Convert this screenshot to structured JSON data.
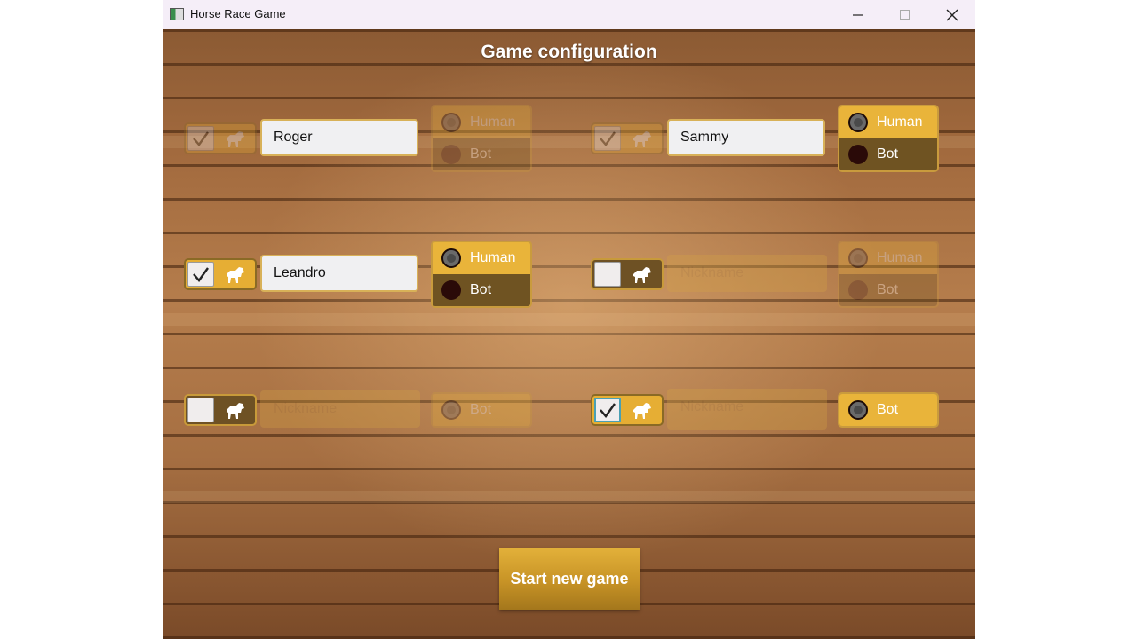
{
  "window": {
    "title": "Horse Race Game",
    "controls": {
      "minimize": "minimize-icon",
      "maximize": "maximize-icon",
      "close": "close-icon"
    }
  },
  "page": {
    "title": "Game configuration",
    "start_button": "Start new game"
  },
  "players": [
    {
      "enabled": true,
      "name": "Roger",
      "placeholder": "",
      "type_options": [
        "Human",
        "Bot"
      ],
      "selected": "Bot",
      "dimmed": true
    },
    {
      "enabled": true,
      "name": "Sammy",
      "placeholder": "",
      "type_options": [
        "Human",
        "Bot"
      ],
      "selected": "Human",
      "dimmed": false
    },
    {
      "enabled": true,
      "name": "Leandro",
      "placeholder": "",
      "type_options": [
        "Human",
        "Bot"
      ],
      "selected": "Human",
      "dimmed": false
    },
    {
      "enabled": false,
      "name": "",
      "placeholder": "Nickname",
      "type_options": [
        "Human",
        "Bot"
      ],
      "selected": "Human",
      "dimmed": true
    },
    {
      "enabled": false,
      "name": "",
      "placeholder": "Nickname",
      "type_options": [
        "Bot"
      ],
      "selected": "Bot",
      "dimmed": true
    },
    {
      "enabled": true,
      "name": "",
      "placeholder": "Nickname",
      "type_options": [
        "Bot"
      ],
      "selected": "Bot",
      "dimmed": false
    }
  ],
  "colors": {
    "accent": "#e9b43a",
    "dark_option": "#6f5322",
    "title_text": "#ffffff"
  }
}
